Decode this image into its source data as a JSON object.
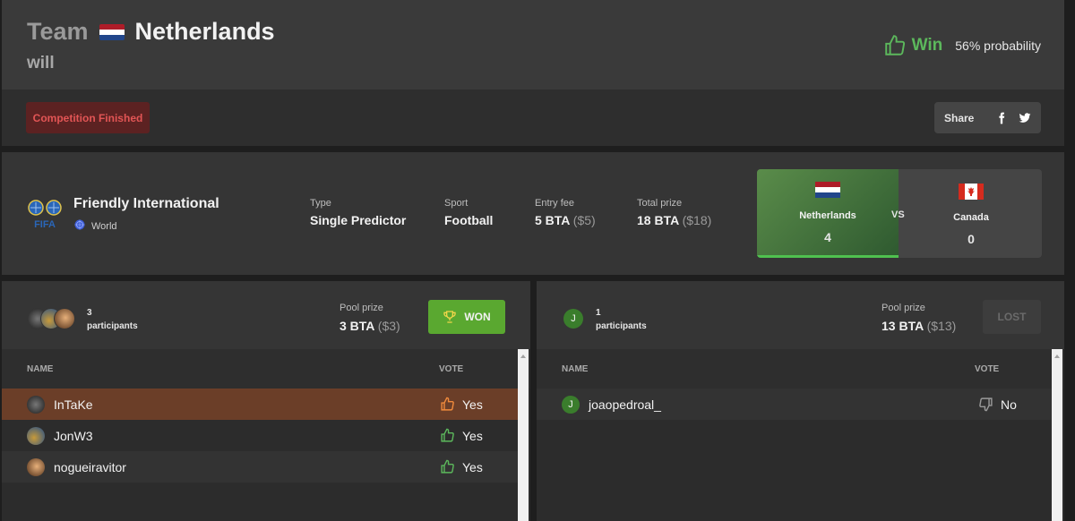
{
  "header": {
    "team_prefix": "Team",
    "team_name": "Netherlands",
    "subtitle": "will",
    "prediction": "Win",
    "probability": "56% probability",
    "colors": {
      "win": "#5cb85c"
    }
  },
  "status": {
    "badge": "Competition Finished",
    "share_label": "Share",
    "share_icons": [
      "facebook-icon",
      "twitter-icon"
    ]
  },
  "competition": {
    "name": "Friendly International",
    "region": "World",
    "type_label": "Type",
    "type_value": "Single Predictor",
    "sport_label": "Sport",
    "sport_value": "Football",
    "entry_label": "Entry fee",
    "entry_value": "5 BTA",
    "entry_sub": "($5)",
    "prize_label": "Total prize",
    "prize_value": "18 BTA",
    "prize_sub": "($18)"
  },
  "match": {
    "home": {
      "name": "Netherlands",
      "score": "4"
    },
    "vs": "VS",
    "away": {
      "name": "Canada",
      "score": "0"
    }
  },
  "pool_win": {
    "participants_count": "3",
    "participants_label": "participants",
    "pool_label": "Pool prize",
    "pool_value": "3 BTA",
    "pool_sub": "($3)",
    "button": "WON",
    "col_name": "NAME",
    "col_vote": "VOTE",
    "rows": [
      {
        "name": "InTaKe",
        "vote": "Yes"
      },
      {
        "name": "JonW3",
        "vote": "Yes"
      },
      {
        "name": "nogueiravitor",
        "vote": "Yes"
      }
    ]
  },
  "pool_lose": {
    "avatar_letter": "J",
    "participants_count": "1",
    "participants_label": "participants",
    "pool_label": "Pool prize",
    "pool_value": "13 BTA",
    "pool_sub": "($13)",
    "button": "LOST",
    "col_name": "NAME",
    "col_vote": "VOTE",
    "rows": [
      {
        "avatar_letter": "J",
        "name": "joaopedroal_",
        "vote": "No"
      }
    ]
  }
}
